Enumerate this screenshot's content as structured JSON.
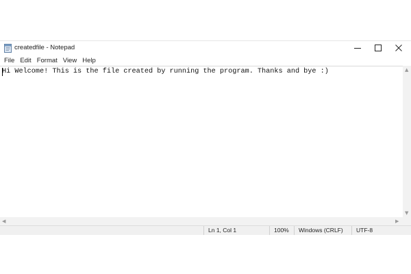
{
  "window": {
    "title": "createdfile - Notepad"
  },
  "menu": {
    "items": [
      {
        "label": "File"
      },
      {
        "label": "Edit"
      },
      {
        "label": "Format"
      },
      {
        "label": "View"
      },
      {
        "label": "Help"
      }
    ]
  },
  "editor": {
    "content": "Hi Welcome! This is the file created by running the program. Thanks and bye :)"
  },
  "status": {
    "position": "Ln 1, Col 1",
    "zoom": "100%",
    "line_ending": "Windows (CRLF)",
    "encoding": "UTF-8"
  },
  "icons": {
    "app": "notepad-icon",
    "minimize": "minimize-icon",
    "maximize": "maximize-icon",
    "close": "close-icon"
  }
}
